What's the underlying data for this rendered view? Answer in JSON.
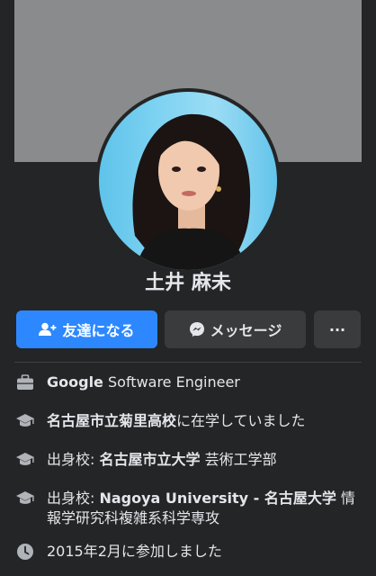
{
  "profile": {
    "name": "土井 麻未"
  },
  "actions": {
    "add_friend": "友達になる",
    "message": "メッセージ",
    "more": "···"
  },
  "intro": [
    {
      "icon": "briefcase-icon",
      "bold": "Google",
      "normal_after": " Software Engineer"
    },
    {
      "icon": "graduation-cap-icon",
      "bold": "名古屋市立菊里高校",
      "normal_after": "に在学していました"
    },
    {
      "icon": "graduation-cap-icon",
      "prefix": "出身校: ",
      "bold": "名古屋市立大学",
      "normal_after": " 芸術工学部"
    },
    {
      "icon": "graduation-cap-icon",
      "prefix": "出身校: ",
      "bold": "Nagoya University - 名古屋大学",
      "normal_after": " 情報学研究科複雑系科学専攻"
    },
    {
      "icon": "clock-icon",
      "text": "2015年2月に参加しました"
    }
  ],
  "colors": {
    "background": "#242526",
    "accent": "#2d88ff",
    "secondary_button": "#3a3b3c",
    "cover": "#8a8b8d"
  }
}
